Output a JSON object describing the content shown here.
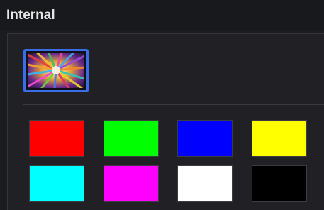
{
  "header": {
    "title": "Internal"
  },
  "media": {
    "thumbnail_icon": "color-burst-image-icon",
    "selected": true,
    "accent_color": "#3a6ee6"
  },
  "swatches": [
    {
      "name": "red",
      "color": "#ff0000"
    },
    {
      "name": "green",
      "color": "#00ff00"
    },
    {
      "name": "blue",
      "color": "#0000ff"
    },
    {
      "name": "yellow",
      "color": "#ffff00"
    },
    {
      "name": "cyan",
      "color": "#00ffff"
    },
    {
      "name": "magenta",
      "color": "#ff00ff"
    },
    {
      "name": "white",
      "color": "#ffffff"
    },
    {
      "name": "black",
      "color": "#000000"
    }
  ]
}
